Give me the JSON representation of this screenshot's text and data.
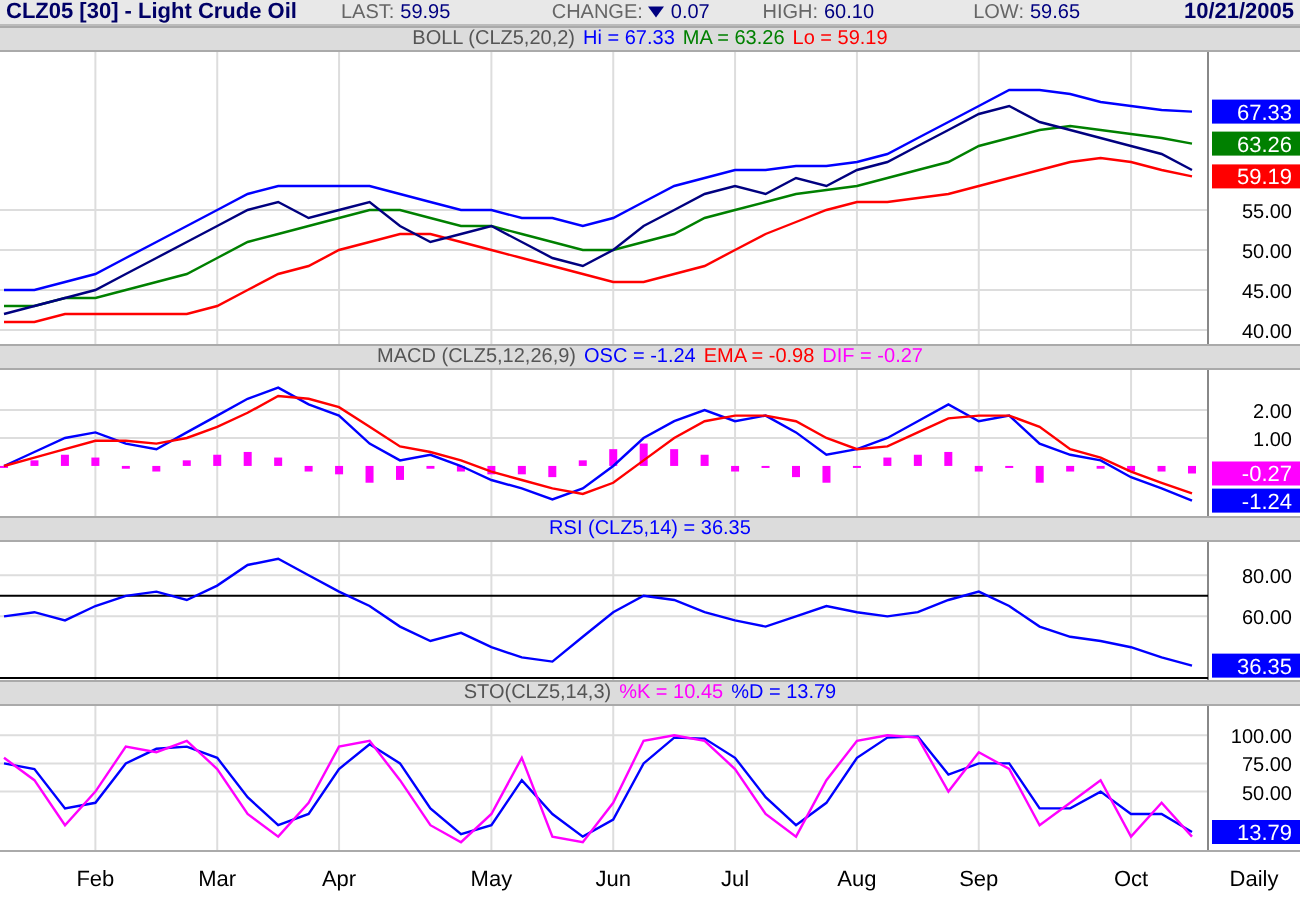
{
  "header": {
    "title": "CLZ05 [30] - Light Crude Oil",
    "fields": [
      {
        "label": "LAST:",
        "value": "59.95"
      },
      {
        "label": "CHANGE:",
        "value": "0.07",
        "falling": true
      },
      {
        "label": "HIGH:",
        "value": "60.10"
      },
      {
        "label": "LOW:",
        "value": "59.65"
      }
    ],
    "date": "10/21/2005"
  },
  "panels": [
    {
      "title": {
        "text": "BOLL (CLZ5,20,2)",
        "color": "#555555"
      },
      "readouts": [
        {
          "text": "Hi = 67.33",
          "color": "#0000ff"
        },
        {
          "text": "MA = 63.26",
          "color": "#008000"
        },
        {
          "text": "Lo = 59.19",
          "color": "#ff0000"
        }
      ],
      "value_boxes": [
        {
          "text": "67.33",
          "color": "#0000ff"
        },
        {
          "text": "63.26",
          "color": "#008000"
        },
        {
          "text": "59.19",
          "color": "#ff0000"
        }
      ],
      "chart_data": {
        "type": "line",
        "grid": true,
        "ylim": [
          38.25,
          74.75
        ],
        "yticks": [
          {
            "value": 40,
            "label": "40.00"
          },
          {
            "value": 45,
            "label": "45.00"
          },
          {
            "value": 50,
            "label": "50.00"
          },
          {
            "value": 55,
            "label": "55.00"
          }
        ],
        "series": [
          {
            "color": "#0000ff",
            "values": [
              45,
              45,
              46,
              47,
              49,
              51,
              53,
              55,
              57,
              58,
              58,
              58,
              58,
              57,
              56,
              55,
              55,
              54,
              54,
              53,
              54,
              56,
              58,
              59,
              60,
              60,
              60.5,
              60.5,
              61,
              62,
              64,
              66,
              68,
              70,
              70,
              69.5,
              68.5,
              68,
              67.5,
              67.3
            ]
          },
          {
            "color": "#008000",
            "values": [
              43,
              43,
              44,
              44,
              45,
              46,
              47,
              49,
              51,
              52,
              53,
              54,
              55,
              55,
              54,
              53,
              53,
              52,
              51,
              50,
              50,
              51,
              52,
              54,
              55,
              56,
              57,
              57.5,
              58,
              59,
              60,
              61,
              63,
              64,
              65,
              65.5,
              65,
              64.5,
              64,
              63.3
            ]
          },
          {
            "color": "#ff0000",
            "values": [
              41,
              41,
              42,
              42,
              42,
              42,
              42,
              43,
              45,
              47,
              48,
              50,
              51,
              52,
              52,
              51,
              50,
              49,
              48,
              47,
              46,
              46,
              47,
              48,
              50,
              52,
              53.5,
              55,
              56,
              56,
              56.5,
              57,
              58,
              59,
              60,
              61,
              61.5,
              61,
              60,
              59.2
            ]
          },
          {
            "color": "#000080",
            "values": [
              42,
              43,
              44,
              45,
              47,
              49,
              51,
              53,
              55,
              56,
              54,
              55,
              56,
              53,
              51,
              52,
              53,
              51,
              49,
              48,
              50,
              53,
              55,
              57,
              58,
              57,
              59,
              58,
              60,
              61,
              63,
              65,
              67,
              68,
              66,
              65,
              64,
              63,
              62,
              60
            ]
          }
        ]
      }
    },
    {
      "title": {
        "text": "MACD (CLZ5,12,26,9)",
        "color": "#555555"
      },
      "readouts": [
        {
          "text": "OSC = -1.24",
          "color": "#0000ff"
        },
        {
          "text": "EMA = -0.98",
          "color": "#ff0000"
        },
        {
          "text": "DIF = -0.27",
          "color": "#ff00ff"
        }
      ],
      "value_boxes": [
        {
          "text": "-0.27",
          "color": "#ff00ff"
        },
        {
          "text": "-1.24",
          "color": "#0000ff"
        }
      ],
      "chart_data": {
        "type": "line",
        "grid": true,
        "ylim": [
          -1.79,
          3.43
        ],
        "yticks": [
          {
            "value": 1,
            "label": "1.00"
          },
          {
            "value": 2,
            "label": "2.00"
          }
        ],
        "series": [
          {
            "type": "bar",
            "color": "#ff00ff",
            "values": [
              0,
              0.2,
              0.4,
              0.3,
              -0.1,
              -0.2,
              0.2,
              0.4,
              0.5,
              0.3,
              -0.2,
              -0.3,
              -0.6,
              -0.5,
              -0.1,
              -0.2,
              -0.3,
              -0.3,
              -0.4,
              0.2,
              0.6,
              0.8,
              0.6,
              0.4,
              -0.2,
              0,
              -0.4,
              -0.6,
              0,
              0.3,
              0.4,
              0.5,
              -0.2,
              0,
              -0.6,
              -0.2,
              -0.1,
              -0.2,
              -0.2,
              -0.27
            ]
          },
          {
            "color": "#0000ff",
            "values": [
              0,
              0.5,
              1,
              1.2,
              0.8,
              0.6,
              1.2,
              1.8,
              2.4,
              2.8,
              2.2,
              1.8,
              0.8,
              0.2,
              0.4,
              0,
              -0.5,
              -0.8,
              -1.2,
              -0.8,
              0,
              1,
              1.6,
              2,
              1.6,
              1.8,
              1.2,
              0.4,
              0.6,
              1,
              1.6,
              2.2,
              1.6,
              1.8,
              0.8,
              0.4,
              0.2,
              -0.4,
              -0.8,
              -1.24
            ]
          },
          {
            "color": "#ff0000",
            "values": [
              0,
              0.3,
              0.6,
              0.9,
              0.9,
              0.8,
              1,
              1.4,
              1.9,
              2.5,
              2.4,
              2.1,
              1.4,
              0.7,
              0.5,
              0.2,
              -0.2,
              -0.5,
              -0.8,
              -1,
              -0.6,
              0.2,
              1,
              1.6,
              1.8,
              1.8,
              1.6,
              1,
              0.6,
              0.7,
              1.2,
              1.7,
              1.8,
              1.8,
              1.4,
              0.6,
              0.3,
              -0.2,
              -0.6,
              -0.98
            ]
          }
        ]
      }
    },
    {
      "title": {
        "text": "RSI (CLZ5,14) = 36.35",
        "color": "#0000ff"
      },
      "value_boxes": [
        {
          "text": "36.35",
          "color": "#0000ff"
        }
      ],
      "chart_data": {
        "type": "line",
        "grid": true,
        "ylim": [
          29,
          96.2
        ],
        "yticks": [
          {
            "value": 60,
            "label": "60.00"
          },
          {
            "value": 80,
            "label": "80.00"
          }
        ],
        "ref_lines": [
          {
            "axis": "y",
            "value": 70
          },
          {
            "axis": "y",
            "value": 30
          }
        ],
        "series": [
          {
            "color": "#0000ff",
            "values": [
              60,
              62,
              58,
              65,
              70,
              72,
              68,
              75,
              85,
              88,
              80,
              72,
              65,
              55,
              48,
              52,
              45,
              40,
              38,
              50,
              62,
              70,
              68,
              62,
              58,
              55,
              60,
              65,
              62,
              60,
              62,
              68,
              72,
              65,
              55,
              50,
              48,
              45,
              40,
              36
            ]
          }
        ]
      }
    },
    {
      "title": {
        "text": "STO(CLZ5,14,3)",
        "color": "#555555"
      },
      "readouts": [
        {
          "text": "%K = 10.45",
          "color": "#ff00ff"
        },
        {
          "text": "%D = 13.79",
          "color": "#0000ff"
        }
      ],
      "value_boxes": [
        {
          "text": "13.79",
          "color": "#0000ff"
        }
      ],
      "chart_data": {
        "type": "line",
        "grid": true,
        "ylim": [
          -2,
          126
        ],
        "yticks": [
          {
            "value": 50,
            "label": "50.00"
          },
          {
            "value": 75,
            "label": "75.00"
          },
          {
            "value": 100,
            "label": "100.00"
          }
        ],
        "categories": [
          null,
          null,
          null,
          "Feb",
          null,
          null,
          null,
          "Mar",
          null,
          null,
          null,
          "Apr",
          null,
          null,
          null,
          null,
          "May",
          null,
          null,
          null,
          "Jun",
          null,
          null,
          null,
          "Jul",
          null,
          null,
          null,
          "Aug",
          null,
          null,
          null,
          "Sep",
          null,
          null,
          null,
          null,
          "Oct",
          null,
          null
        ],
        "series": [
          {
            "color": "#0000ff",
            "values": [
              75,
              70,
              35,
              40,
              75,
              88,
              90,
              80,
              45,
              20,
              30,
              70,
              92,
              75,
              35,
              12,
              20,
              60,
              30,
              10,
              25,
              75,
              98,
              97,
              80,
              45,
              20,
              40,
              80,
              98,
              99,
              65,
              75,
              75,
              35,
              35,
              50,
              30,
              30,
              14
            ]
          },
          {
            "color": "#ff00ff",
            "values": [
              80,
              60,
              20,
              50,
              90,
              85,
              95,
              70,
              30,
              10,
              40,
              90,
              95,
              60,
              20,
              5,
              30,
              80,
              10,
              5,
              40,
              95,
              100,
              95,
              70,
              30,
              10,
              60,
              95,
              100,
              98,
              50,
              85,
              70,
              20,
              40,
              60,
              10,
              40,
              10
            ]
          }
        ]
      }
    }
  ],
  "period": "Daily"
}
